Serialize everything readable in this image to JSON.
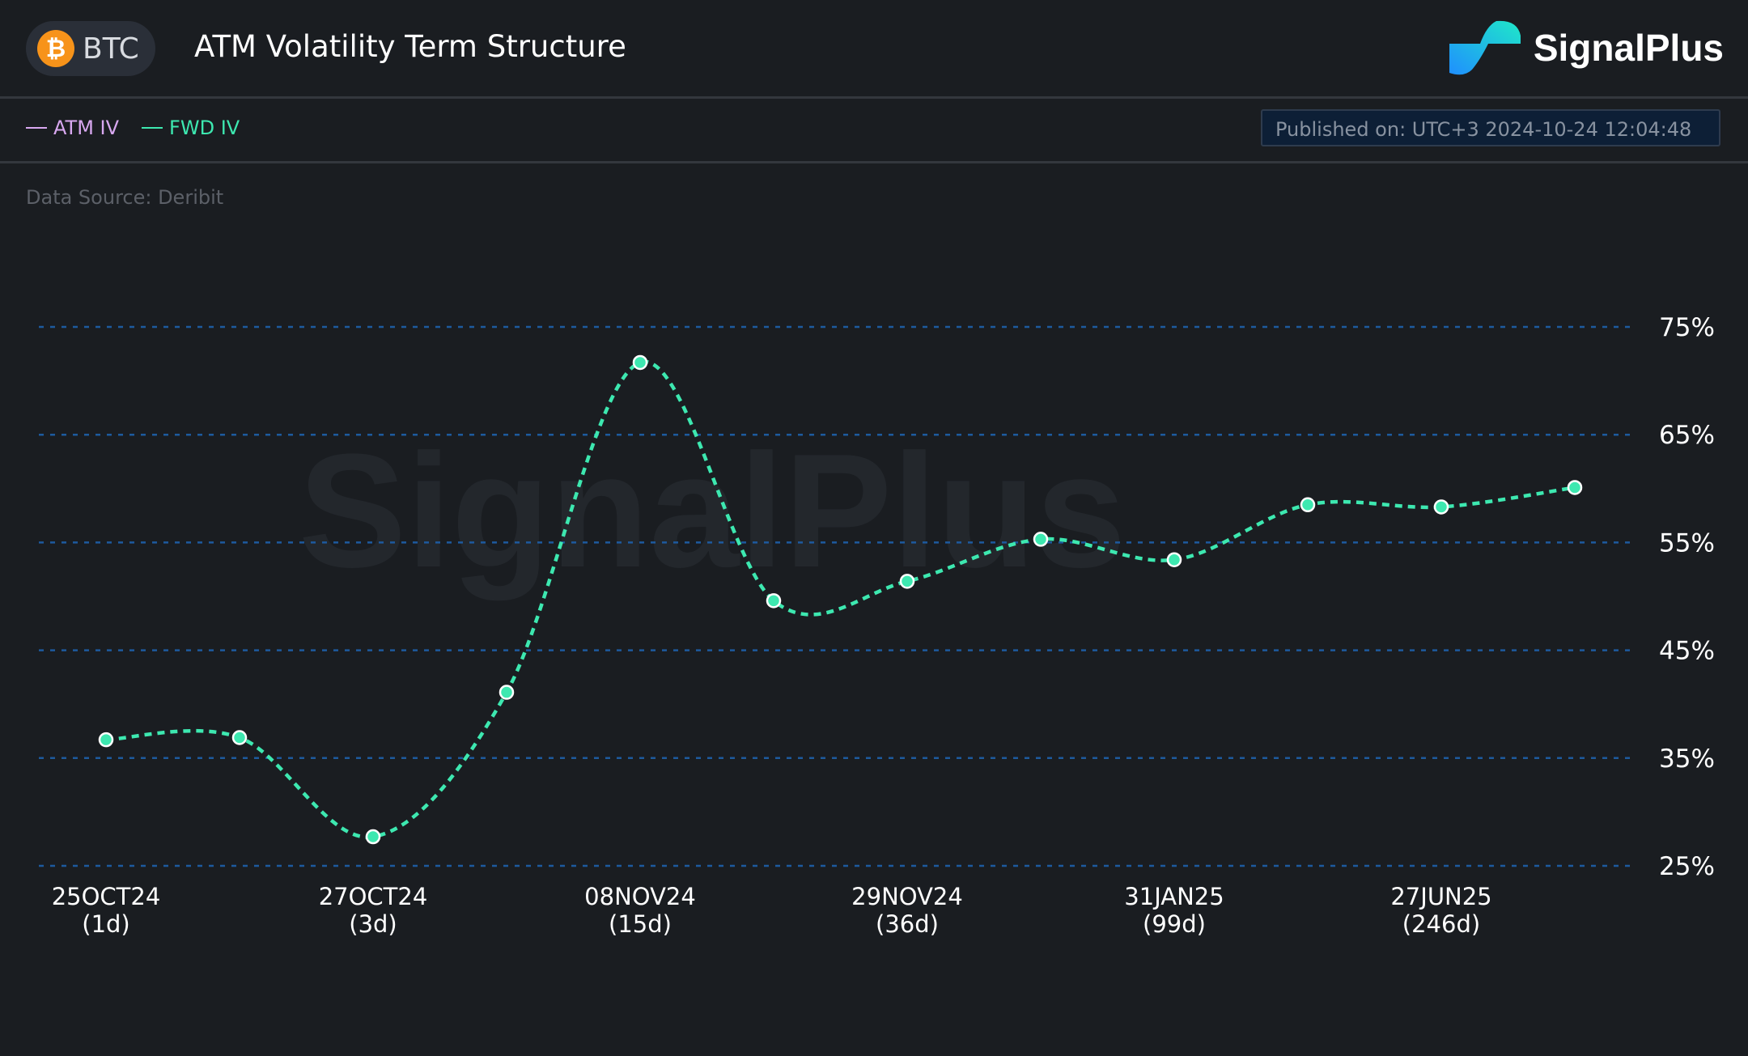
{
  "header": {
    "asset": "BTC",
    "asset_icon": "bitcoin-icon",
    "title": "ATM Volatility Term Structure",
    "brand": "SignalPlus"
  },
  "legend": [
    {
      "label": "ATM IV",
      "color": "#d8a8f0"
    },
    {
      "label": "FWD IV",
      "color": "#3de8b0"
    }
  ],
  "published": "Published on: UTC+3 2024-10-24 12:04:48",
  "source": "Data Source: Deribit",
  "watermark": "SignalPlus",
  "chart_data": {
    "type": "line",
    "title": "",
    "xlabel": "",
    "ylabel": "",
    "categories": [
      {
        "date": "25OCT24",
        "days": "(1d)"
      },
      {
        "date": "",
        "days": ""
      },
      {
        "date": "27OCT24",
        "days": "(3d)"
      },
      {
        "date": "",
        "days": ""
      },
      {
        "date": "08NOV24",
        "days": "(15d)"
      },
      {
        "date": "",
        "days": ""
      },
      {
        "date": "29NOV24",
        "days": "(36d)"
      },
      {
        "date": "",
        "days": ""
      },
      {
        "date": "31JAN25",
        "days": "(99d)"
      },
      {
        "date": "",
        "days": ""
      },
      {
        "date": "27JUN25",
        "days": "(246d)"
      },
      {
        "date": "",
        "days": ""
      }
    ],
    "series": [
      {
        "name": "FWD IV",
        "color": "#3de8b0",
        "values": [
          36.7,
          36.9,
          27.7,
          41.1,
          71.7,
          49.6,
          51.4,
          55.3,
          53.4,
          58.5,
          58.3,
          60.1
        ]
      }
    ],
    "yticks": [
      "25%",
      "35%",
      "45%",
      "55%",
      "65%",
      "75%"
    ],
    "ytick_values": [
      25,
      35,
      45,
      55,
      65,
      75
    ],
    "ylim": [
      25,
      75
    ],
    "grid": true,
    "grid_color": "#1d5a9e",
    "legend_position": "top-left"
  }
}
